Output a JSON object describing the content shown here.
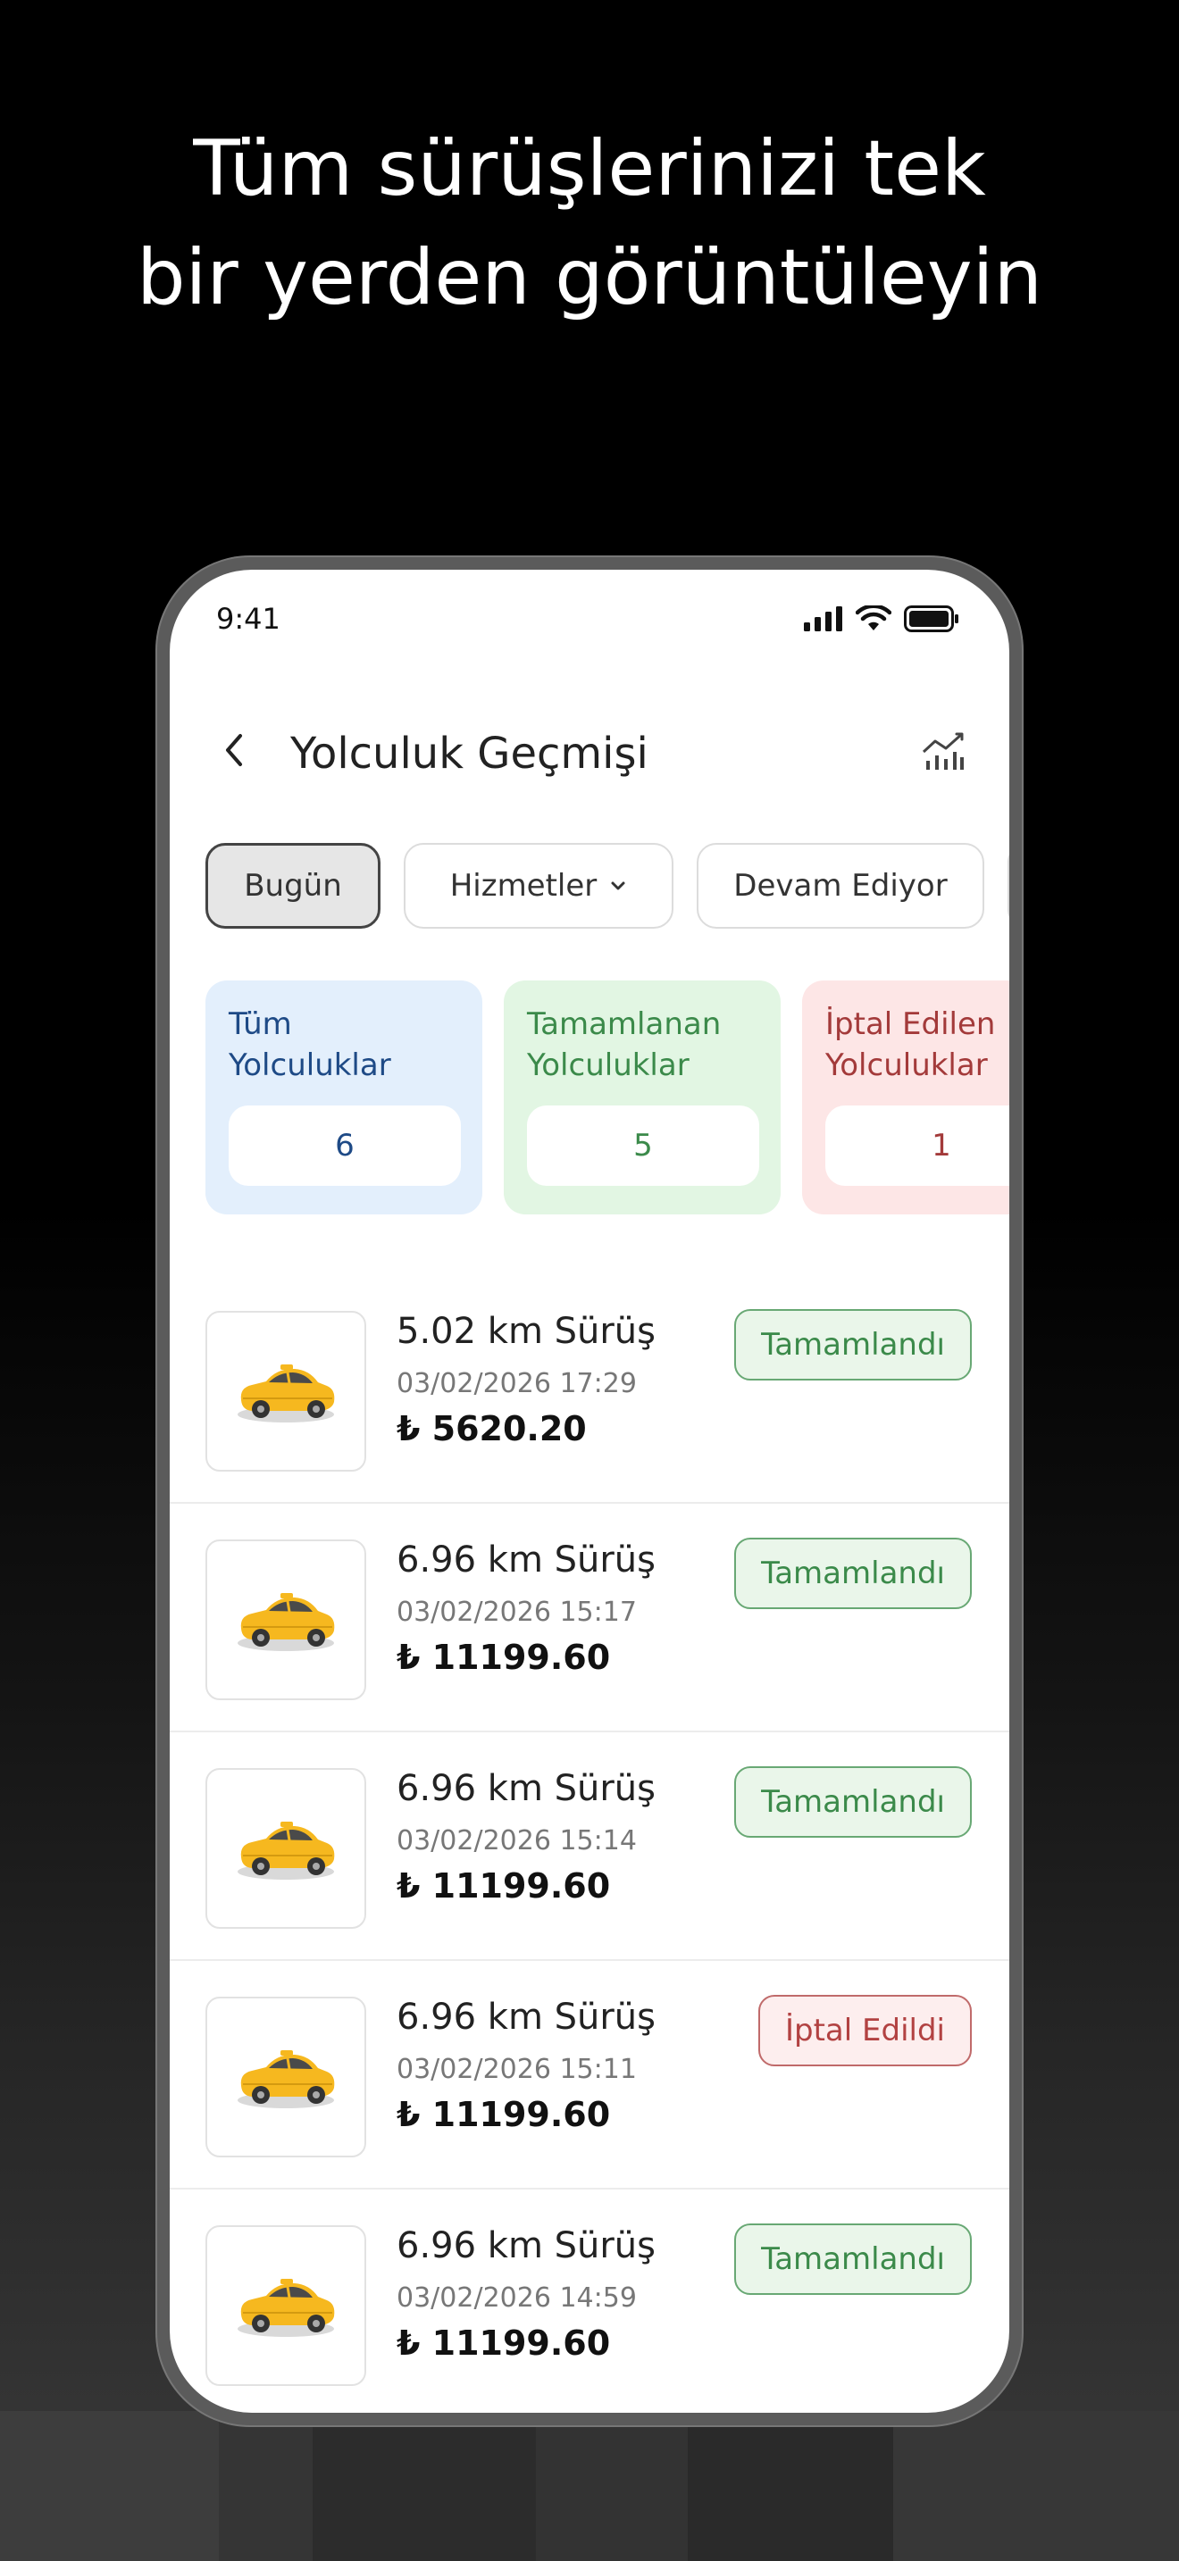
{
  "headline": {
    "line1": "Tüm sürüşlerinizi tek",
    "line2": "bir yerden görüntüleyin"
  },
  "status_bar": {
    "time": "9:41",
    "icons": [
      "signal-icon",
      "wifi-icon",
      "battery-icon"
    ]
  },
  "app_bar": {
    "back_icon": "chevron-left-icon",
    "title": "Yolculuk Geçmişi",
    "action_icon": "chart-icon"
  },
  "filters": [
    {
      "label": "Bugün",
      "active": true
    },
    {
      "label": "Hizmetler",
      "dropdown": true
    },
    {
      "label": "Devam Ediyor"
    }
  ],
  "summary": [
    {
      "label": "Tüm\nYolculuklar",
      "value": "6",
      "color": "#1e4a86"
    },
    {
      "label": "Tamamlanan\nYolculuklar",
      "value": "5",
      "color": "#3b8a4a"
    },
    {
      "label": "İptal Edilen\nYolculuklar",
      "value": "1",
      "color": "#a33a3a"
    }
  ],
  "rides": [
    {
      "title": "5.02 km Sürüş",
      "date": "03/02/2026 17:29",
      "price": "₺ 5620.20",
      "status": "Tamamlandı",
      "status_type": "done"
    },
    {
      "title": "6.96 km Sürüş",
      "date": "03/02/2026 15:17",
      "price": "₺ 11199.60",
      "status": "Tamamlandı",
      "status_type": "done"
    },
    {
      "title": "6.96 km Sürüş",
      "date": "03/02/2026 15:14",
      "price": "₺ 11199.60",
      "status": "Tamamlandı",
      "status_type": "done"
    },
    {
      "title": "6.96 km Sürüş",
      "date": "03/02/2026 15:11",
      "price": "₺ 11199.60",
      "status": "İptal Edildi",
      "status_type": "cancel"
    },
    {
      "title": "6.96 km Sürüş",
      "date": "03/02/2026 14:59",
      "price": "₺ 11199.60",
      "status": "Tamamlandı",
      "status_type": "done"
    }
  ],
  "colors": {
    "done": "#3b8a4a",
    "cancel": "#b24242",
    "taxi": "#f6b81f"
  }
}
